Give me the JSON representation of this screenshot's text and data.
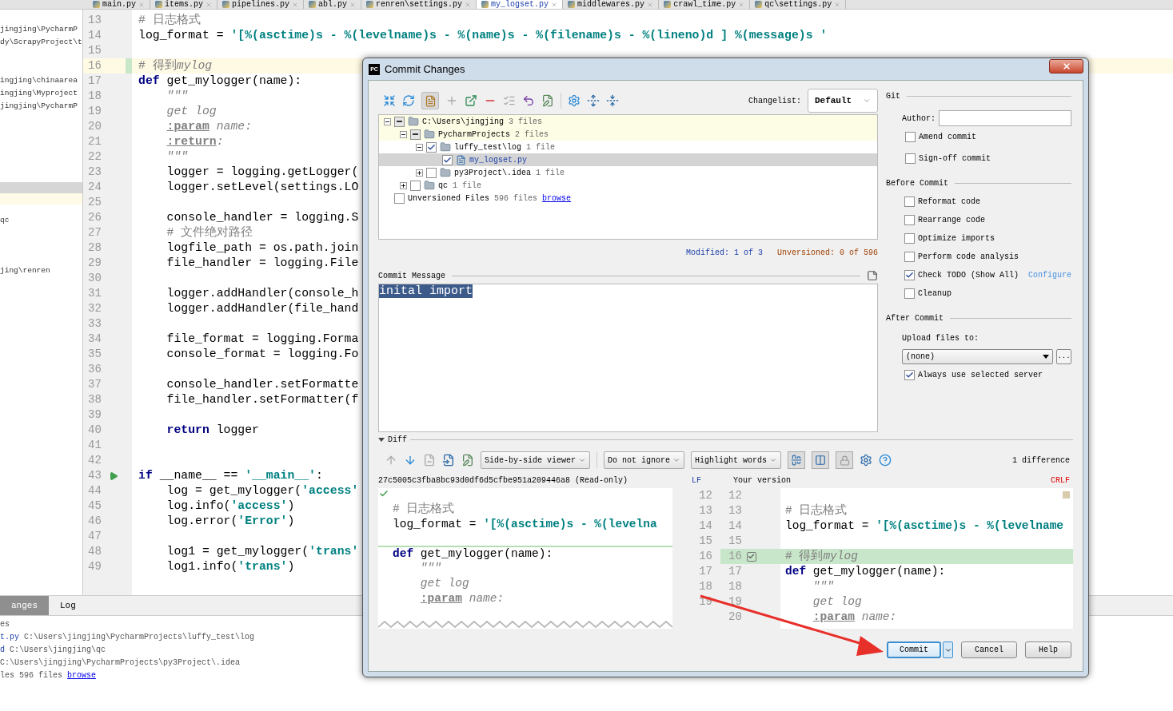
{
  "editor_tabs": [
    {
      "label": "main.py",
      "selected": false
    },
    {
      "label": "items.py",
      "selected": false
    },
    {
      "label": "pipelines.py",
      "selected": false
    },
    {
      "label": "abl.py",
      "selected": false
    },
    {
      "label": "renren\\settings.py",
      "selected": false
    },
    {
      "label": "my_logset.py",
      "selected": true
    },
    {
      "label": "middlewares.py",
      "selected": false
    },
    {
      "label": "crawl_time.py",
      "selected": false
    },
    {
      "label": "qc\\settings.py",
      "selected": false
    }
  ],
  "project_panel": {
    "items": [
      "jingjing\\PycharmP",
      "dy\\ScrapyProject\\t",
      "ingjing\\chinaarea",
      "ingjing\\Myproject",
      "jingjing\\PycharmP",
      "qc",
      "jing\\renren"
    ]
  },
  "editor": {
    "lines": [
      {
        "number": "13",
        "current": false,
        "run": false,
        "segments": [
          {
            "kind": "comment",
            "text": "# 日志格式"
          }
        ]
      },
      {
        "number": "14",
        "current": false,
        "run": false,
        "segments": [
          {
            "kind": "plain",
            "text": "log_format = "
          },
          {
            "kind": "string",
            "text": "'[%(asctime)s - %(levelname)s - %(name)s - %(filename)s - %(lineno)d ] %(message)s '"
          }
        ]
      },
      {
        "number": "15",
        "current": false,
        "run": false
      },
      {
        "number": "16",
        "current": true,
        "run": false,
        "segments": [
          {
            "kind": "comment",
            "text": "# 得到"
          },
          {
            "kind": "doc",
            "text": "mylog"
          }
        ]
      },
      {
        "number": "17",
        "current": false,
        "run": false,
        "segments": [
          {
            "kind": "keyword",
            "text": "def"
          },
          {
            "kind": "plain",
            "text": " get_mylogger(name):"
          }
        ]
      },
      {
        "number": "18",
        "current": false,
        "run": false,
        "segments": [
          {
            "kind": "doc",
            "text": "    \"\"\""
          }
        ]
      },
      {
        "number": "19",
        "current": false,
        "run": false,
        "segments": [
          {
            "kind": "doc",
            "text": "    get log"
          }
        ]
      },
      {
        "number": "20",
        "current": false,
        "run": false,
        "indented": true,
        "segments": [
          {
            "kind": "tag",
            "text": ":param"
          },
          {
            "kind": "doc",
            "text": " name:"
          }
        ]
      },
      {
        "number": "21",
        "current": false,
        "run": false,
        "indented": true,
        "segments": [
          {
            "kind": "tag",
            "text": ":return"
          },
          {
            "kind": "doc",
            "text": ":"
          }
        ]
      },
      {
        "number": "22",
        "current": false,
        "run": false,
        "segments": [
          {
            "kind": "doc",
            "text": "    \"\"\""
          }
        ]
      },
      {
        "number": "23",
        "current": false,
        "run": false,
        "segments": [
          {
            "kind": "plain",
            "text": "    logger = logging.getLogger("
          }
        ]
      },
      {
        "number": "24",
        "current": false,
        "run": false,
        "segments": [
          {
            "kind": "plain",
            "text": "    logger.setLevel(settings.LO"
          }
        ]
      },
      {
        "number": "25",
        "current": false,
        "run": false
      },
      {
        "number": "26",
        "current": false,
        "run": false,
        "segments": [
          {
            "kind": "plain",
            "text": "    console_handler = logging.S"
          }
        ]
      },
      {
        "number": "27",
        "current": false,
        "run": false,
        "segments": [
          {
            "kind": "comment",
            "text": "    # 文件绝对路径"
          }
        ]
      },
      {
        "number": "28",
        "current": false,
        "run": false,
        "segments": [
          {
            "kind": "plain",
            "text": "    logfile_path = os.path.join"
          }
        ]
      },
      {
        "number": "29",
        "current": false,
        "run": false,
        "segments": [
          {
            "kind": "plain",
            "text": "    file_handler = logging.File"
          }
        ]
      },
      {
        "number": "30",
        "current": false,
        "run": false
      },
      {
        "number": "31",
        "current": false,
        "run": false,
        "segments": [
          {
            "kind": "plain",
            "text": "    logger.addHandler(console_h"
          }
        ]
      },
      {
        "number": "32",
        "current": false,
        "run": false,
        "segments": [
          {
            "kind": "plain",
            "text": "    logger.addHandler(file_hand"
          }
        ]
      },
      {
        "number": "33",
        "current": false,
        "run": false
      },
      {
        "number": "34",
        "current": false,
        "run": false,
        "segments": [
          {
            "kind": "plain",
            "text": "    file_format = logging.Forma"
          }
        ]
      },
      {
        "number": "35",
        "current": false,
        "run": false,
        "segments": [
          {
            "kind": "plain",
            "text": "    console_format = logging.Fo"
          }
        ]
      },
      {
        "number": "36",
        "current": false,
        "run": false
      },
      {
        "number": "37",
        "current": false,
        "run": false,
        "segments": [
          {
            "kind": "plain",
            "text": "    console_handler.setFormatte"
          }
        ]
      },
      {
        "number": "38",
        "current": false,
        "run": false,
        "segments": [
          {
            "kind": "plain",
            "text": "    file_handler.setFormatter(f"
          }
        ]
      },
      {
        "number": "39",
        "current": false,
        "run": false
      },
      {
        "number": "40",
        "current": false,
        "run": false,
        "segments": [
          {
            "kind": "keyword",
            "text": "    return"
          },
          {
            "kind": "plain",
            "text": " logger"
          }
        ]
      },
      {
        "number": "41",
        "current": false,
        "run": false
      },
      {
        "number": "42",
        "current": false,
        "run": false
      },
      {
        "number": "43",
        "current": false,
        "run": true,
        "segments": [
          {
            "kind": "keyword",
            "text": "if"
          },
          {
            "kind": "plain",
            "text": " __name__ == "
          },
          {
            "kind": "string",
            "text": "'__main__'"
          },
          {
            "kind": "plain",
            "text": ":"
          }
        ]
      },
      {
        "number": "44",
        "current": false,
        "run": false,
        "segments": [
          {
            "kind": "plain",
            "text": "    log = get_mylogger("
          },
          {
            "kind": "string",
            "text": "'access'"
          }
        ]
      },
      {
        "number": "45",
        "current": false,
        "run": false,
        "segments": [
          {
            "kind": "plain",
            "text": "    log.info("
          },
          {
            "kind": "string",
            "text": "'access'"
          },
          {
            "kind": "plain",
            "text": ")"
          }
        ]
      },
      {
        "number": "46",
        "current": false,
        "run": false,
        "segments": [
          {
            "kind": "plain",
            "text": "    log.error("
          },
          {
            "kind": "string",
            "text": "'Error'"
          },
          {
            "kind": "plain",
            "text": ")"
          }
        ]
      },
      {
        "number": "47",
        "current": false,
        "run": false
      },
      {
        "number": "48",
        "current": false,
        "run": false,
        "segments": [
          {
            "kind": "plain",
            "text": "    log1 = get_mylogger("
          },
          {
            "kind": "string",
            "text": "'trans'"
          }
        ]
      },
      {
        "number": "49",
        "current": false,
        "run": false,
        "segments": [
          {
            "kind": "plain",
            "text": "    log1.info("
          },
          {
            "kind": "string",
            "text": "'trans'"
          },
          {
            "kind": "plain",
            "text": ")"
          }
        ]
      }
    ]
  },
  "bottom_panel": {
    "tabs": [
      {
        "label": "anges",
        "selected": true
      },
      {
        "label": "Log",
        "selected": false
      }
    ],
    "lines": [
      {
        "segments": [
          {
            "kind": "gray",
            "text": "es"
          }
        ]
      },
      {
        "segments": [
          {
            "kind": "name",
            "text": "t.py"
          },
          {
            "kind": "gray",
            "text": " C:\\Users\\jingjing\\PycharmProjects\\luffy_test\\log"
          }
        ]
      },
      {
        "segments": [
          {
            "kind": "name",
            "text": "d"
          },
          {
            "kind": "gray",
            "text": " C:\\Users\\jingjing\\qc"
          }
        ]
      },
      {
        "segments": [
          {
            "kind": "gray",
            "text": "C:\\Users\\jingjing\\PycharmProjects\\py3Project\\.idea"
          }
        ]
      },
      {
        "segments": [
          {
            "kind": "gray",
            "text": "les 596 files "
          }
        ],
        "link": "browse"
      }
    ]
  },
  "dialog": {
    "title": "Commit Changes",
    "logo": "PC",
    "changelist_label": "Changelist:",
    "changelist": "Default",
    "tree": [
      {
        "kind": "folder",
        "name": "C:\\Users\\jingjing",
        "count": "3 files",
        "partial": true,
        "expanded": true,
        "selected": false,
        "highlighted": true,
        "children": [
          {
            "kind": "folder",
            "name": "PycharmProjects",
            "count": "2 files",
            "partial": true,
            "expanded": true,
            "selected": false,
            "highlighted": true,
            "children": [
              {
                "kind": "folder",
                "name": "luffy_test\\log",
                "count": "1 file",
                "checked": true,
                "partial": false,
                "expanded": true,
                "selected": false,
                "highlighted": false,
                "children": [
                  {
                    "kind": "file",
                    "name": "my_logset.py",
                    "checked": true,
                    "partial": false,
                    "selected": true
                  }
                ]
              },
              {
                "kind": "folder",
                "name": "py3Project\\.idea",
                "count": "1 file",
                "checked": false,
                "partial": false,
                "expanded": false,
                "selected": false,
                "highlighted": false
              }
            ]
          },
          {
            "kind": "folder",
            "name": "qc",
            "count": "1 file",
            "checked": false,
            "partial": false,
            "expanded": false,
            "selected": false,
            "highlighted": false
          }
        ]
      },
      {
        "kind": "group",
        "name": "Unversioned Files",
        "count": "596 files",
        "link": "browse",
        "checked": false,
        "partial": false,
        "selected": false,
        "highlighted": false
      }
    ],
    "modified": "Modified: 1 of 3",
    "unversioned": "Unversioned: 0 of 596",
    "message_label": "Commit Message",
    "message": "inital import",
    "git": {
      "title": "Git",
      "author_label": "Author:",
      "options": [
        {
          "label": "Amend commit",
          "checked": false
        },
        {
          "label": "Sign-off commit",
          "checked": false
        }
      ]
    },
    "before_commit": {
      "title": "Before Commit",
      "options": [
        {
          "label": "Reformat code",
          "checked": false
        },
        {
          "label": "Rearrange code",
          "checked": false
        },
        {
          "label": "Optimize imports",
          "checked": false
        },
        {
          "label": "Perform code analysis",
          "checked": false
        },
        {
          "label": "Check TODO (Show All)",
          "checked": true,
          "link": "Configure"
        },
        {
          "label": "Cleanup",
          "checked": false
        }
      ]
    },
    "after_commit": {
      "title": "After Commit",
      "upload_label": "Upload files to:",
      "upload_server": "(none)",
      "browse_button": "...",
      "options": [
        {
          "label": "Always use selected server",
          "checked": true
        }
      ]
    },
    "diff": {
      "title": "Diff",
      "expanded": true,
      "viewer": "Side-by-side viewer",
      "ignore": "Do not ignore",
      "highlight": "Highlight words",
      "differences": "1 difference",
      "left_title": "27c5005c3fba8bc93d0df6d5cfbe951a209446a8 (Read-only)",
      "left_separator": "LF",
      "right_title": "Your version",
      "right_separator": "CRLF",
      "rows": [
        {
          "left_number": "12",
          "right_number": "12",
          "changed": false
        },
        {
          "left_number": "13",
          "right_number": "13",
          "changed": false,
          "left": [
            {
              "kind": "comment",
              "text": "# 日志格式"
            }
          ],
          "right": [
            {
              "kind": "comment",
              "text": "# 日志格式"
            }
          ]
        },
        {
          "left_number": "14",
          "right_number": "14",
          "changed": false,
          "left": [
            {
              "kind": "plain",
              "text": "log_format = "
            },
            {
              "kind": "string",
              "text": "'[%(asctime)s - %(levelna"
            }
          ],
          "right": [
            {
              "kind": "plain",
              "text": "log_format = "
            },
            {
              "kind": "string",
              "text": "'[%(asctime)s - %(levelname"
            }
          ]
        },
        {
          "left_number": "15",
          "right_number": "15",
          "changed": false
        },
        {
          "left_number": "16",
          "right_number": "16",
          "changed": true,
          "left": [
            {
              "kind": "keyword",
              "text": "def"
            },
            {
              "kind": "plain",
              "text": " get_mylogger(name):"
            }
          ],
          "right": [
            {
              "kind": "comment",
              "text": "# 得到"
            },
            {
              "kind": "doc",
              "text": "mylog"
            }
          ]
        },
        {
          "left_number": "17",
          "right_number": "17",
          "changed": false,
          "left": [
            {
              "kind": "doc",
              "text": "    \"\"\""
            }
          ],
          "right": [
            {
              "kind": "keyword",
              "text": "def"
            },
            {
              "kind": "plain",
              "text": " get_mylogger(name):"
            }
          ]
        },
        {
          "left_number": "18",
          "right_number": "18",
          "changed": false,
          "left": [
            {
              "kind": "doc",
              "text": "    get log"
            }
          ],
          "right": [
            {
              "kind": "doc",
              "text": "    \"\"\""
            }
          ]
        },
        {
          "left_number": "19",
          "right_number": "19",
          "changed": false,
          "left_indented": true,
          "left": [
            {
              "kind": "tag",
              "text": ":param"
            },
            {
              "kind": "doc",
              "text": " name:"
            }
          ],
          "right": [
            {
              "kind": "doc",
              "text": "    get log"
            }
          ]
        },
        {
          "right_number": "20",
          "changed": false,
          "right_indented": true,
          "right": [
            {
              "kind": "tag",
              "text": ":param"
            },
            {
              "kind": "doc",
              "text": " name:"
            }
          ]
        }
      ]
    },
    "buttons": [
      {
        "label": "Commit",
        "default": true,
        "has_menu": true
      },
      {
        "label": "Cancel",
        "default": false,
        "has_menu": false
      },
      {
        "label": "Help",
        "default": false,
        "has_menu": false
      }
    ]
  }
}
